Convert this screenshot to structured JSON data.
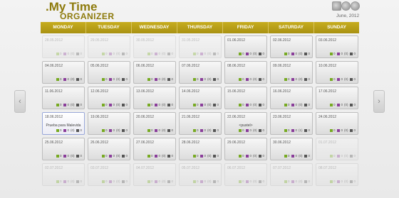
{
  "logo": {
    "line1": "My Time",
    "line2": "ORGANIZER"
  },
  "tools": {
    "icon1": "tools-icon",
    "icon2": "gear-icon",
    "icon3": "help-icon"
  },
  "month_label": "June, 2012",
  "days": [
    "MONDAY",
    "TUESDAY",
    "WEDNESDAY",
    "THURSDAY",
    "FRIDAY",
    "SATURDAY",
    "SUNDAY"
  ],
  "nav": {
    "prev": "‹",
    "next": "›"
  },
  "weeks": [
    [
      "28.05.2012",
      "29.05.2012",
      "30.05.2012",
      "31.05.2012",
      "01.06.2012",
      "02.06.2012",
      "03.06.2012"
    ],
    [
      "04.06.2012",
      "05.06.2012",
      "06.06.2012",
      "07.06.2012",
      "08.06.2012",
      "09.06.2012",
      "10.06.2012"
    ],
    [
      "11.06.2012",
      "12.06.2012",
      "13.06.2012",
      "14.06.2012",
      "15.06.2012",
      "16.06.2012",
      "17.06.2012"
    ],
    [
      "18.06.2012",
      "19.06.2012",
      "20.06.2012",
      "21.06.2012",
      "22.06.2012",
      "23.06.2012",
      "24.06.2012"
    ],
    [
      "25.06.2012",
      "26.06.2012",
      "27.06.2012",
      "28.06.2012",
      "29.06.2012",
      "30.06.2012",
      "01.07.2012"
    ],
    [
      "02.07.2012",
      "03.07.2012",
      "04.07.2012",
      "05.07.2012",
      "06.07.2012",
      "07.07.2012",
      "08.07.2012"
    ]
  ],
  "events": {
    "3-0": "Prueba para Malevida",
    "3-4": "<pustel>"
  },
  "stat": {
    "a": "0",
    "b": "0",
    "c": "(0)",
    "d": "0"
  },
  "stat_alt": {
    "c": "(1)"
  }
}
